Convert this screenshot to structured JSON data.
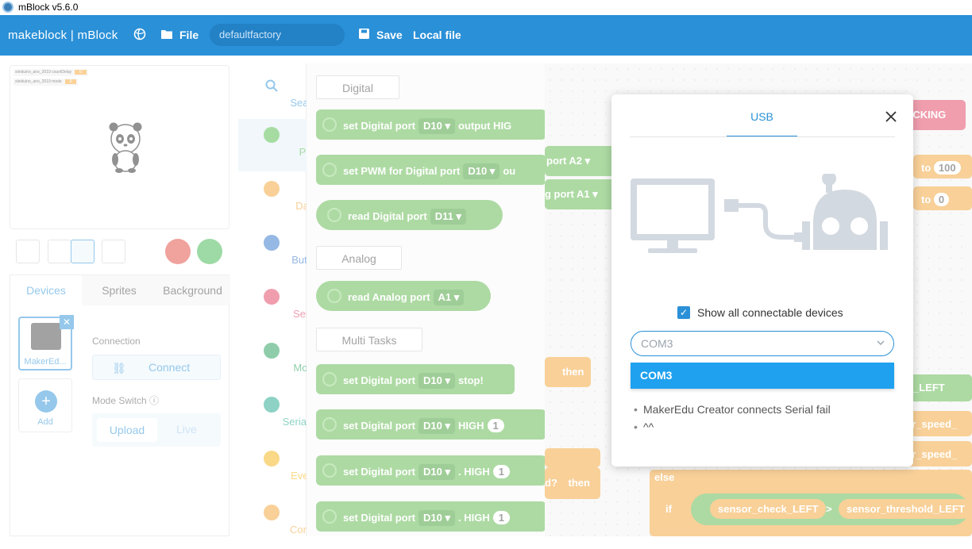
{
  "window": {
    "title": "mBlock v5.6.0"
  },
  "menubar": {
    "logo": "makeblock | mBlock",
    "file_label": "File",
    "project_name": "defaultfactory",
    "save_label": "Save",
    "local_file_label": "Local file"
  },
  "stage": {
    "variables": [
      {
        "name": "sleiduino_ano_2019 countDelay",
        "value": "0"
      },
      {
        "name": "sleiduino_ano_2019 mode",
        "value": "0"
      }
    ]
  },
  "device_panel": {
    "tabs": [
      "Devices",
      "Sprites",
      "Background"
    ],
    "device_name": "MakerEd...",
    "add_label": "Add",
    "connection_label": "Connection",
    "connect_button": "Connect",
    "mode_switch_label": "Mode Switch",
    "upload_label": "Upload",
    "live_label": "Live"
  },
  "categories": [
    {
      "label": "Search",
      "color": "#2a90d7"
    },
    {
      "label": "Pin",
      "color": "#4cb944"
    },
    {
      "label": "Data",
      "color": "#f0a030"
    },
    {
      "label": "Button",
      "color": "#2a70c8"
    },
    {
      "label": "Servo",
      "color": "#e03c5c"
    },
    {
      "label": "Motor",
      "color": "#1f9a55"
    },
    {
      "label": "Serial Port",
      "color": "#1aa58a"
    },
    {
      "label": "Events",
      "color": "#f2b10f"
    },
    {
      "label": "Control",
      "color": "#f0a030"
    }
  ],
  "palette": {
    "headers": [
      "Digital",
      "Analog",
      "Multi Tasks"
    ],
    "blocks": [
      {
        "text": "set Digital port",
        "dd": "D10 ▾",
        "tail": "output  HIG"
      },
      {
        "text": "set PWM for Digital port",
        "dd": "D10 ▾",
        "tail": "ou"
      },
      {
        "text": "read Digital port",
        "dd": "D11 ▾",
        "tail": ""
      },
      {
        "text": "read Analog port",
        "dd": "A1 ▾",
        "tail": ""
      },
      {
        "text": "set Digital port",
        "dd": "D10 ▾",
        "tail": "stop!"
      },
      {
        "text": "set Digital port",
        "dd": "D10 ▾",
        "tail": "HIGH",
        "num": "1"
      },
      {
        "text": "set Digital port",
        "dd": "D10 ▾",
        "tail": ". HIGH",
        "num": "1"
      },
      {
        "text": "set Digital port",
        "dd": "D10 ▾",
        "tail": ". HIGH",
        "num": "1"
      }
    ]
  },
  "workspace": {
    "tracking_label": "ACKING",
    "to_100": "100",
    "to_0": "0",
    "to_label": "to",
    "port_a2": "port  A2 ▾",
    "port_a1": "g port  A1 ▾",
    "then_label": "then",
    "then_label2": "then",
    "d_label": "d?",
    "left_label": "_LEFT",
    "motor_speed": "otor_speed_",
    "else_label": "else",
    "if_label": "if",
    "sensor_check": "sensor_check_LEFT",
    "gt": ">",
    "sensor_threshold": "sensor_threshold_LEFT"
  },
  "dialog": {
    "tab": "USB",
    "show_all_label": "Show all connectable devices",
    "show_all_checked": true,
    "select_value": "COM3",
    "options": [
      "COM3"
    ],
    "hints": [
      "MakerEdu Creator connects Serial fail",
      "^^"
    ]
  }
}
